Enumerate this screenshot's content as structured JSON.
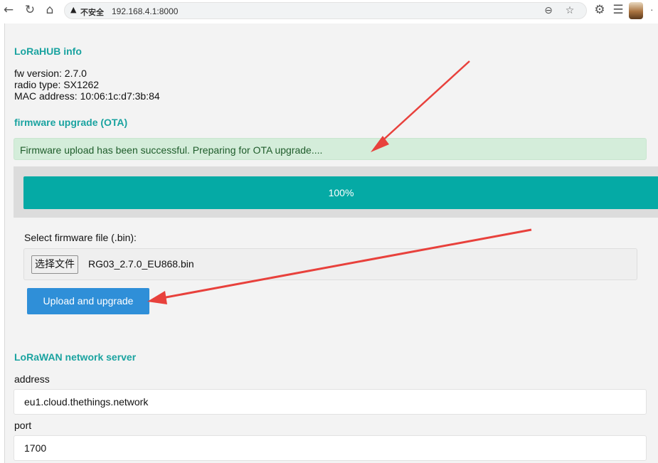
{
  "browser": {
    "back_icon": "back-arrow-icon",
    "insecure_label": "不安全",
    "url": "192.168.4.1:8000"
  },
  "lorahub": {
    "title": "LoRaHUB info",
    "fw_version": "fw version: 2.7.0",
    "radio_type": "radio type: SX1262",
    "mac_address": "MAC address: 10:06:1c:d7:3b:84"
  },
  "ota": {
    "title": "firmware upgrade (OTA)",
    "alert": "Firmware upload has been successful. Preparing for OTA upgrade....",
    "progress_label": "100%",
    "progress_fraction": 1.0,
    "select_label": "Select firmware file (.bin):",
    "choose_file_button": "选择文件",
    "file_name": "RG03_2.7.0_EU868.bin",
    "upload_button": "Upload and upgrade"
  },
  "network": {
    "title": "LoRaWAN network server",
    "address_label": "address",
    "address_value": "eu1.cloud.thethings.network",
    "port_label": "port",
    "port_value": "1700"
  },
  "colors": {
    "accent": "#1aa3a0",
    "progress": "#05aaa5",
    "button": "#2f8fd8",
    "annotation_arrow": "#e8413c"
  }
}
